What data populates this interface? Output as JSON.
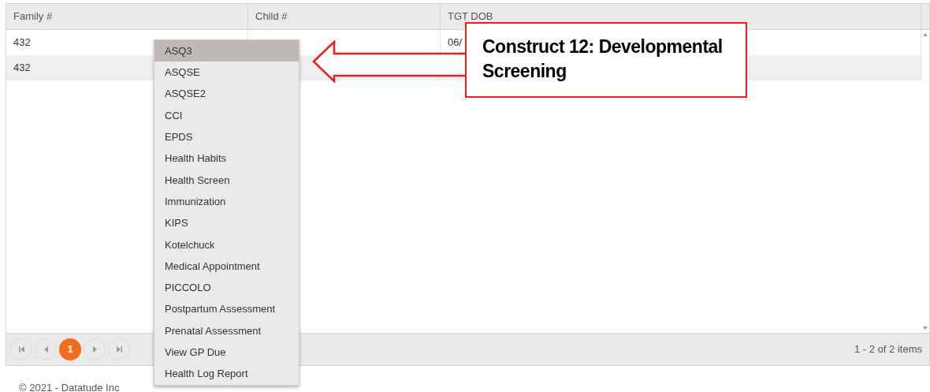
{
  "table": {
    "columns": [
      "Family #",
      "Child #",
      "TGT DOB"
    ],
    "rows": [
      [
        "432",
        "",
        "06/"
      ],
      [
        "432",
        "",
        ""
      ]
    ]
  },
  "pager": {
    "pages": [
      {
        "label": "1",
        "selected": true
      }
    ],
    "summary": "1 - 2 of 2 items"
  },
  "menu": {
    "items": [
      {
        "label": "ASQ3",
        "selected": true
      },
      {
        "label": "ASQSE",
        "selected": false
      },
      {
        "label": "ASQSE2",
        "selected": false
      },
      {
        "label": "CCI",
        "selected": false
      },
      {
        "label": "EPDS",
        "selected": false
      },
      {
        "label": "Health Habits",
        "selected": false
      },
      {
        "label": "Health Screen",
        "selected": false
      },
      {
        "label": "Immunization",
        "selected": false
      },
      {
        "label": "KIPS",
        "selected": false
      },
      {
        "label": "Kotelchuck",
        "selected": false
      },
      {
        "label": "Medical Appointment",
        "selected": false
      },
      {
        "label": "PICCOLO",
        "selected": false
      },
      {
        "label": "Postpartum Assessment",
        "selected": false
      },
      {
        "label": "Prenatal Assessment",
        "selected": false
      },
      {
        "label": "View GP Due",
        "selected": false
      },
      {
        "label": "Health Log Report",
        "selected": false
      }
    ]
  },
  "callout": {
    "text": "Construct 12: Developmental Screening"
  },
  "footer": "© 2021 - Datatude Inc"
}
